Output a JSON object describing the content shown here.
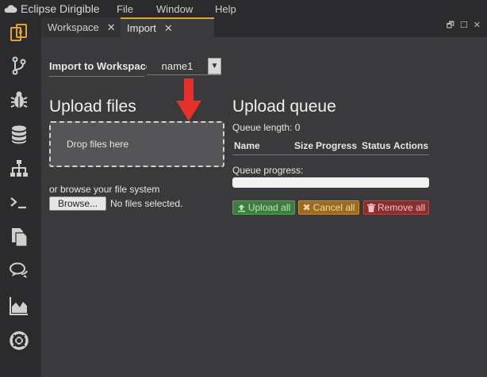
{
  "app": {
    "title": "Eclipse Dirigible"
  },
  "menu": {
    "file": "File",
    "window": "Window",
    "help": "Help"
  },
  "tabs": [
    {
      "label": "Workspace",
      "close": "✕"
    },
    {
      "label": "Import",
      "close": "✕"
    }
  ],
  "window_controls": {
    "restore": "🗗",
    "maximize": "☐",
    "close": "✕"
  },
  "sidebar_icons": [
    "workspace-icon",
    "git-branch-icon",
    "debug-bug-icon",
    "database-icon",
    "hierarchy-icon",
    "terminal-icon",
    "documents-icon",
    "chat-icon",
    "area-chart-icon",
    "help-lifebuoy-icon"
  ],
  "import": {
    "label": "Import to Workspace",
    "workspace_value": "name1"
  },
  "upload": {
    "heading": "Upload files",
    "drop_text": "Drop files here",
    "browse_text": "or browse your file system",
    "browse_button": "Browse...",
    "no_file": "No files selected."
  },
  "queue": {
    "heading": "Upload queue",
    "length_text": "Queue length: 0",
    "columns": [
      "Name",
      "Size",
      "Progress",
      "Status",
      "Actions"
    ],
    "progress_label": "Queue progress:",
    "progress_value": 0,
    "upload_all": "Upload all",
    "cancel_all": "Cancel all",
    "remove_all": "Remove all"
  },
  "colors": {
    "accent": "#e0a33a",
    "success": "#3f7d3f",
    "warning": "#9a6b20",
    "danger": "#8a2f2f",
    "annotation_arrow": "#e8302a"
  }
}
